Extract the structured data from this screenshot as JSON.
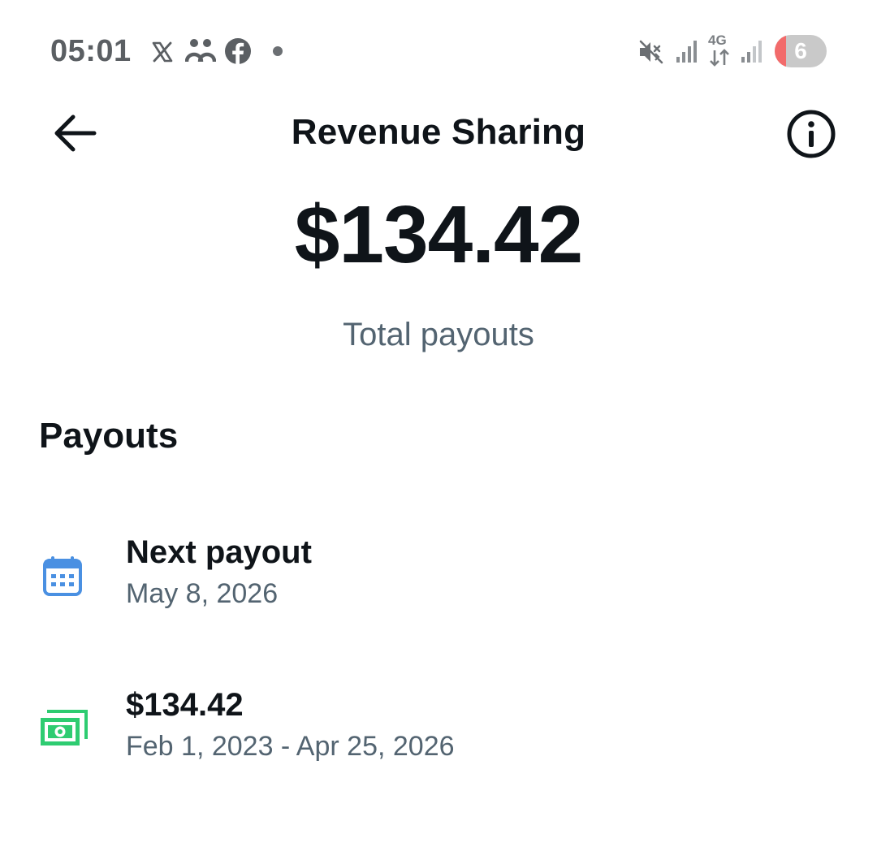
{
  "status_bar": {
    "time": "05:01",
    "network_type": "4G",
    "notification_count": "6",
    "icons": [
      "x-app-icon",
      "community-icon",
      "facebook-icon",
      "notification-dot-icon",
      "mute-icon",
      "signal-icon",
      "data-arrows-icon",
      "signal-icon"
    ]
  },
  "header": {
    "title": "Revenue Sharing",
    "back_icon": "arrow-left-icon",
    "info_icon": "info-circle-icon"
  },
  "summary": {
    "total_amount": "$134.42",
    "total_label": "Total payouts"
  },
  "payouts": {
    "section_title": "Payouts",
    "items": [
      {
        "icon": "calendar-icon",
        "icon_color": "#4a90e2",
        "title": "Next payout",
        "subtitle": "May 8, 2026"
      },
      {
        "icon": "money-bill-icon",
        "icon_color": "#2ecc71",
        "title": "$134.42",
        "subtitle": "Feb 1, 2023 - Apr 25, 2026"
      }
    ]
  },
  "colors": {
    "primary_text": "#0f1419",
    "secondary_text": "#536471",
    "status_text": "#5b5f63",
    "calendar_blue": "#4a90e2",
    "money_green": "#2ecc71",
    "battery_red": "#f26b6b"
  }
}
